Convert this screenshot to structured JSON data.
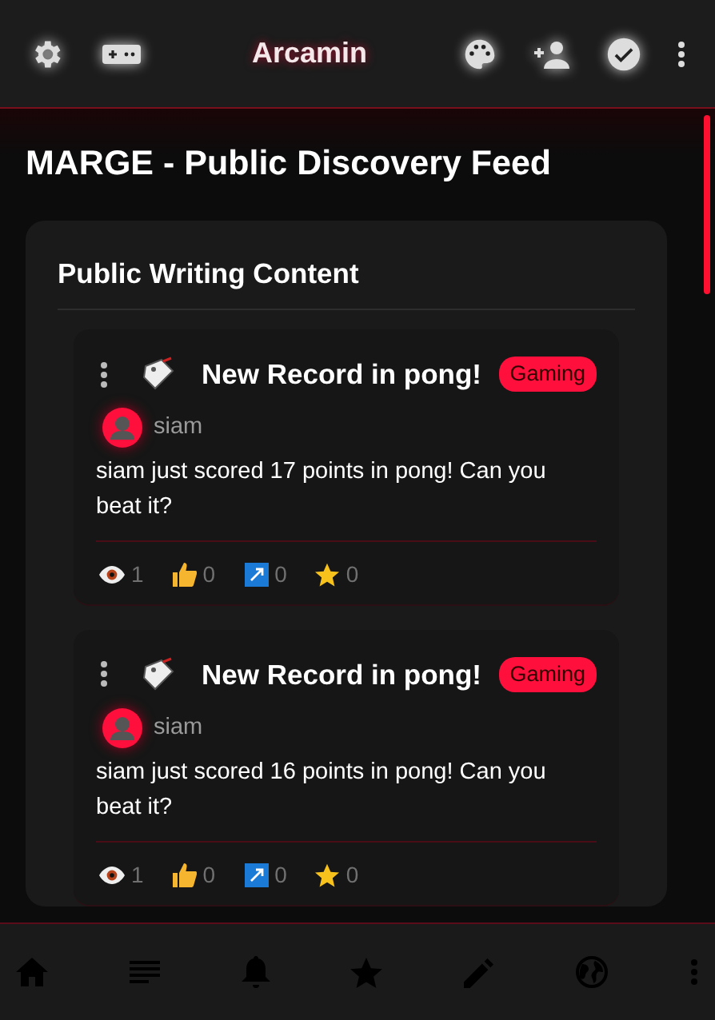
{
  "app_bar": {
    "title": "Arcamin"
  },
  "page_title": "MARGE - Public Discovery Feed",
  "section": {
    "title": "Public Writing Content",
    "posts": [
      {
        "title": "New Record in pong!",
        "tag": "Gaming",
        "author": "siam",
        "body": "siam just scored 17 points in pong! Can you beat it?",
        "views": "1",
        "likes": "0",
        "shares": "0",
        "stars": "0"
      },
      {
        "title": "New Record in pong!",
        "tag": "Gaming",
        "author": "siam",
        "body": "siam just scored 16 points in pong! Can you beat it?",
        "views": "1",
        "likes": "0",
        "shares": "0",
        "stars": "0"
      }
    ]
  }
}
